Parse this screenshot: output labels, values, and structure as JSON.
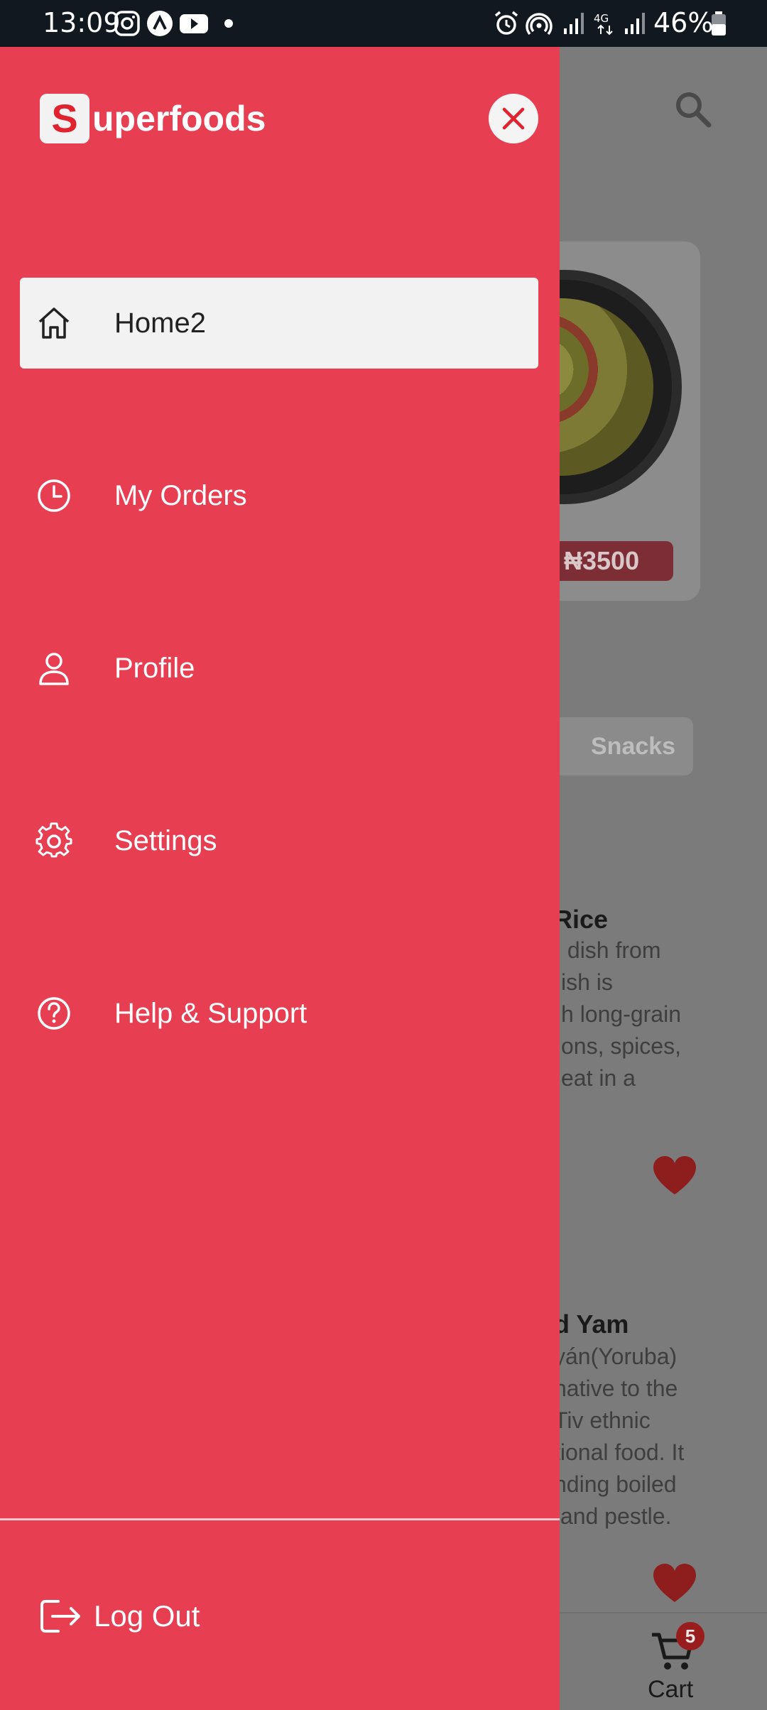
{
  "status_bar": {
    "time": "13:09",
    "battery": "46%",
    "icons": [
      "instagram-icon",
      "app-icon",
      "youtube-icon",
      "dot-icon",
      "alarm-icon",
      "hotspot-icon",
      "signal-icon",
      "4g-icon",
      "signal-icon",
      "battery-icon"
    ]
  },
  "drawer": {
    "brand_initial": "S",
    "brand_rest": "uperfoods",
    "items": [
      {
        "label": "Home2",
        "icon": "home-icon",
        "active": true
      },
      {
        "label": "My Orders",
        "icon": "clock-icon",
        "active": false
      },
      {
        "label": "Profile",
        "icon": "user-icon",
        "active": false
      },
      {
        "label": "Settings",
        "icon": "gear-icon",
        "active": false
      },
      {
        "label": "Help & Support",
        "icon": "help-icon",
        "active": false
      }
    ],
    "logout_label": "Log Out"
  },
  "background": {
    "featured_price": "₦3500",
    "category_chip": "Snacks",
    "items": [
      {
        "title_fragment": "Rice",
        "desc_lines": [
          " dish from",
          "ish is",
          "h long-grain",
          "ons, spices,",
          "eat in a"
        ]
      },
      {
        "title_fragment": "ed Yam",
        "desc_lines": [
          "yán(Yoruba)",
          "native to the",
          "Tiv ethnic",
          "tional food. It",
          "nding boiled",
          " and pestle."
        ]
      }
    ],
    "cart_count": "5",
    "cart_label": "Cart"
  },
  "colors": {
    "drawer_bg": "#e83e51",
    "active_item_bg": "#f2f2f2",
    "status_bar_bg": "#111820"
  }
}
